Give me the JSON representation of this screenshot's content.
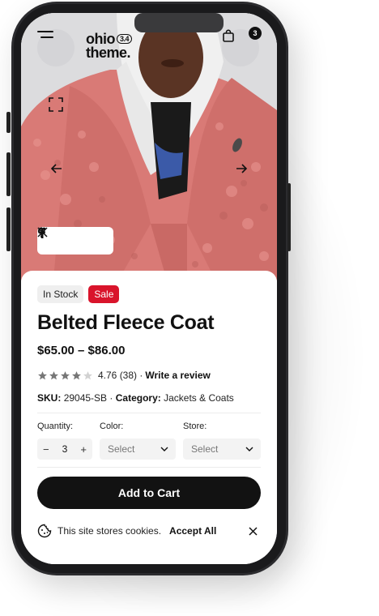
{
  "header": {
    "logo_line1": "ohio",
    "logo_line2": "theme.",
    "logo_version": "3.4",
    "cart_count": "3"
  },
  "product": {
    "badges": {
      "stock": "In Stock",
      "sale": "Sale"
    },
    "title": "Belted Fleece Coat",
    "price": "$65.00 – $86.00",
    "rating": {
      "stars": 4,
      "max": 5,
      "score_text": "4.76 (38) ·",
      "review_link": "Write a review"
    },
    "sku": {
      "label": "SKU:",
      "value": "29045-SB ·",
      "category_label": "Category:",
      "category_value": "Jackets & Coats"
    }
  },
  "options": {
    "quantity": {
      "label": "Quantity:",
      "minus": "−",
      "value": "3",
      "plus": "+"
    },
    "color": {
      "label": "Color:",
      "value": "Select"
    },
    "store": {
      "label": "Store:",
      "value": "Select"
    }
  },
  "actions": {
    "add_to_cart": "Add to Cart"
  },
  "cookie": {
    "text": "This site stores cookies.",
    "accept": "Accept All"
  },
  "colors": {
    "sale": "#d9142b",
    "button": "#121212",
    "coat": "#d97a76"
  },
  "icons": [
    "menu-icon",
    "bag-icon",
    "fullscreen-icon",
    "arrow-left-icon",
    "arrow-right-icon",
    "facebook-icon",
    "x-icon",
    "pinterest-icon",
    "star-icon",
    "chevron-down-icon",
    "cookie-icon",
    "close-icon"
  ]
}
